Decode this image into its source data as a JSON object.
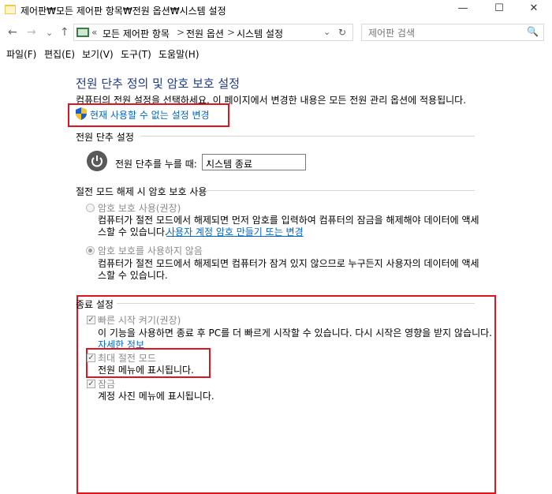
{
  "window": {
    "title": "제어판₩모든 제어판 항목₩전원 옵션₩시스템 설정",
    "minimize": "—",
    "maximize": "☐",
    "close": "✕"
  },
  "nav": {
    "back": "←",
    "forward": "→",
    "recent": "⌄",
    "up": "↑",
    "crumb_prefix": "«",
    "breadcrumbs": [
      "모든 제어판 항목",
      "전원 옵션",
      "시스템 설정"
    ],
    "separator": ">",
    "dropdown": "⌄",
    "refresh": "↻",
    "search_placeholder": "제어판 검색",
    "search_icon": "🔍"
  },
  "menu": [
    "파일(F)",
    "편집(E)",
    "보기(V)",
    "도구(T)",
    "도움말(H)"
  ],
  "main": {
    "heading": "전원 단추 정의 및 암호 보호 설정",
    "description": "컴퓨터의 전원 설정을 선택하세요. 이 페이지에서 변경한 내용은 모든 전원 관리 옵션에 적용됩니다.",
    "change_link": "현재 사용할 수 없는 설정 변경",
    "power_section": {
      "title": "전원 단추 설정",
      "label": "전원 단추를 누를 때:",
      "selected": "시스템 종료",
      "chevron": "⌄"
    },
    "password_section": {
      "title": "절전 모드 해제 시 암호 보호 사용",
      "option1_label": "암호 보호 사용(권장)",
      "option1_desc_line1": "컴퓨터가 절전 모드에서 해제되면 먼저 암호를 입력하여 컴퓨터의 잠금을 해제해야 데이터에 액세",
      "option1_desc_line2": "스할 수 있습니다.",
      "option1_link": "사용자 계정 암호 만들기 또는 변경",
      "option2_label": "암호 보호를 사용하지 않음",
      "option2_desc_line1": "컴퓨터가 절전 모드에서 해제되면 컴퓨터가 잠겨 있지 않으므로 누구든지 사용자의 데이터에 액세",
      "option2_desc_line2": "스할 수 있습니다."
    },
    "shutdown_section": {
      "title": "종료 설정",
      "items": [
        {
          "label": "빠른 시작 켜기(권장)",
          "desc": "이 기능을 사용하면 종료 후 PC를 더 빠르게 시작할 수 있습니다. 다시 시작은 영향을 받지 않습니다.",
          "link": "자세한 정보",
          "check": "✓"
        },
        {
          "label": "최대 절전 모드",
          "desc": "전원 메뉴에 표시됩니다.",
          "check": "✓"
        },
        {
          "label": "잠금",
          "desc": "계정 사진 메뉴에 표시됩니다.",
          "check": "✓"
        }
      ]
    }
  },
  "colors": {
    "heading": "#1e3a8a",
    "link": "#0066cc",
    "highlight_box": "#e0141e"
  },
  "icons": {
    "app": "control-panel-icon",
    "shield": "uac-shield-icon",
    "power": "power-icon"
  }
}
